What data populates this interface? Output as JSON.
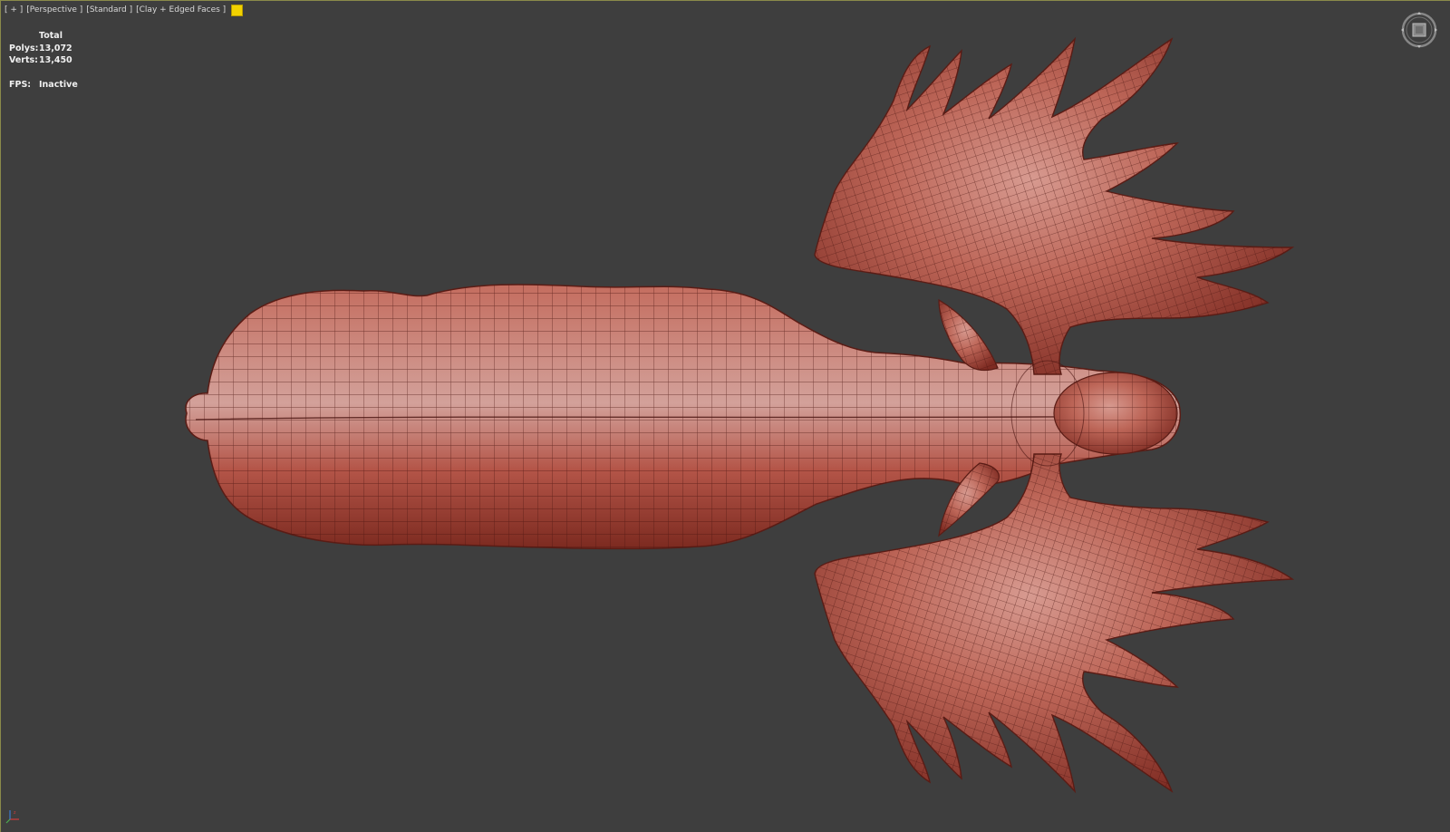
{
  "viewport": {
    "labels": {
      "menu": "[ + ]",
      "view": "[Perspective ]",
      "shading_preset": "[Standard ]",
      "display_mode": "[Clay + Edged Faces ]"
    },
    "swatch_color": "#f2d200",
    "background_color": "#3e3e3e",
    "stats": {
      "header": "Total",
      "polys_label": "Polys:",
      "polys_value": "13,072",
      "verts_label": "Verts:",
      "verts_value": "13,450",
      "fps_label": "FPS:",
      "fps_value": "Inactive"
    },
    "model": {
      "name": "moose-base-mesh",
      "base_color": "#b4554a",
      "wire_color": "#4a1410"
    },
    "icons": {
      "viewcube": "viewcube-icon",
      "axis_tripod": "axis-tripod-icon"
    }
  }
}
